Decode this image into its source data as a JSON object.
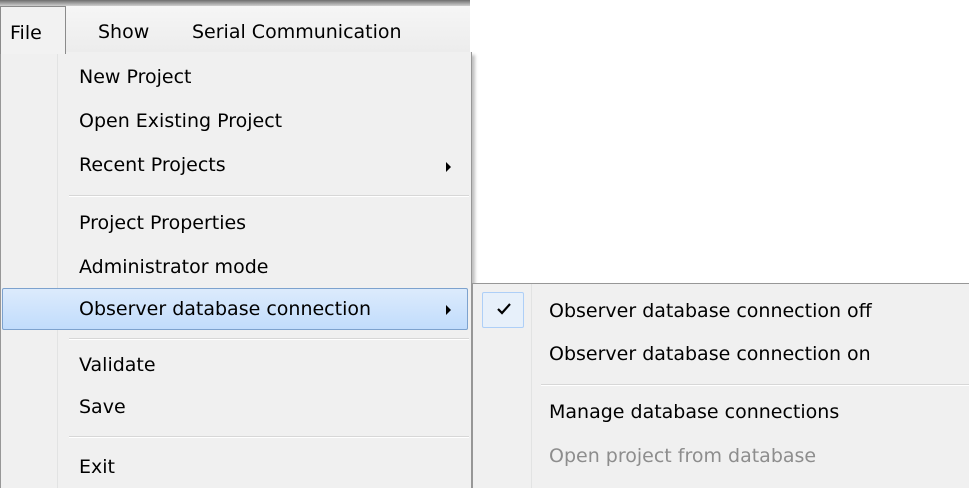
{
  "menubar": {
    "items": [
      {
        "label": "File",
        "active": true
      },
      {
        "label": "Show",
        "active": false
      },
      {
        "label": "Serial Communication",
        "active": false
      }
    ]
  },
  "file_menu": {
    "items": [
      {
        "label": "New Project"
      },
      {
        "label": "Open Existing Project"
      },
      {
        "label": "Recent Projects",
        "has_submenu": true
      },
      {
        "label": "Project Properties"
      },
      {
        "label": "Administrator mode"
      },
      {
        "label": "Observer database connection",
        "has_submenu": true,
        "highlighted": true
      },
      {
        "label": "Validate"
      },
      {
        "label": "Save"
      },
      {
        "label": "Exit"
      }
    ]
  },
  "observer_submenu": {
    "items": [
      {
        "label": "Observer database connection off",
        "checked": true
      },
      {
        "label": "Observer database connection on"
      },
      {
        "label": "Manage database connections"
      },
      {
        "label": "Open project from database",
        "disabled": true
      }
    ]
  },
  "icons": {
    "submenu_arrow": "chevron-right-icon",
    "checkmark": "check-icon"
  },
  "colors": {
    "highlight_top": "#dcebfc",
    "highlight_bottom": "#c1dcfc",
    "highlight_border": "#7da2ce",
    "disabled_text": "#8d8d8d",
    "menu_background": "#f0f0f0"
  }
}
